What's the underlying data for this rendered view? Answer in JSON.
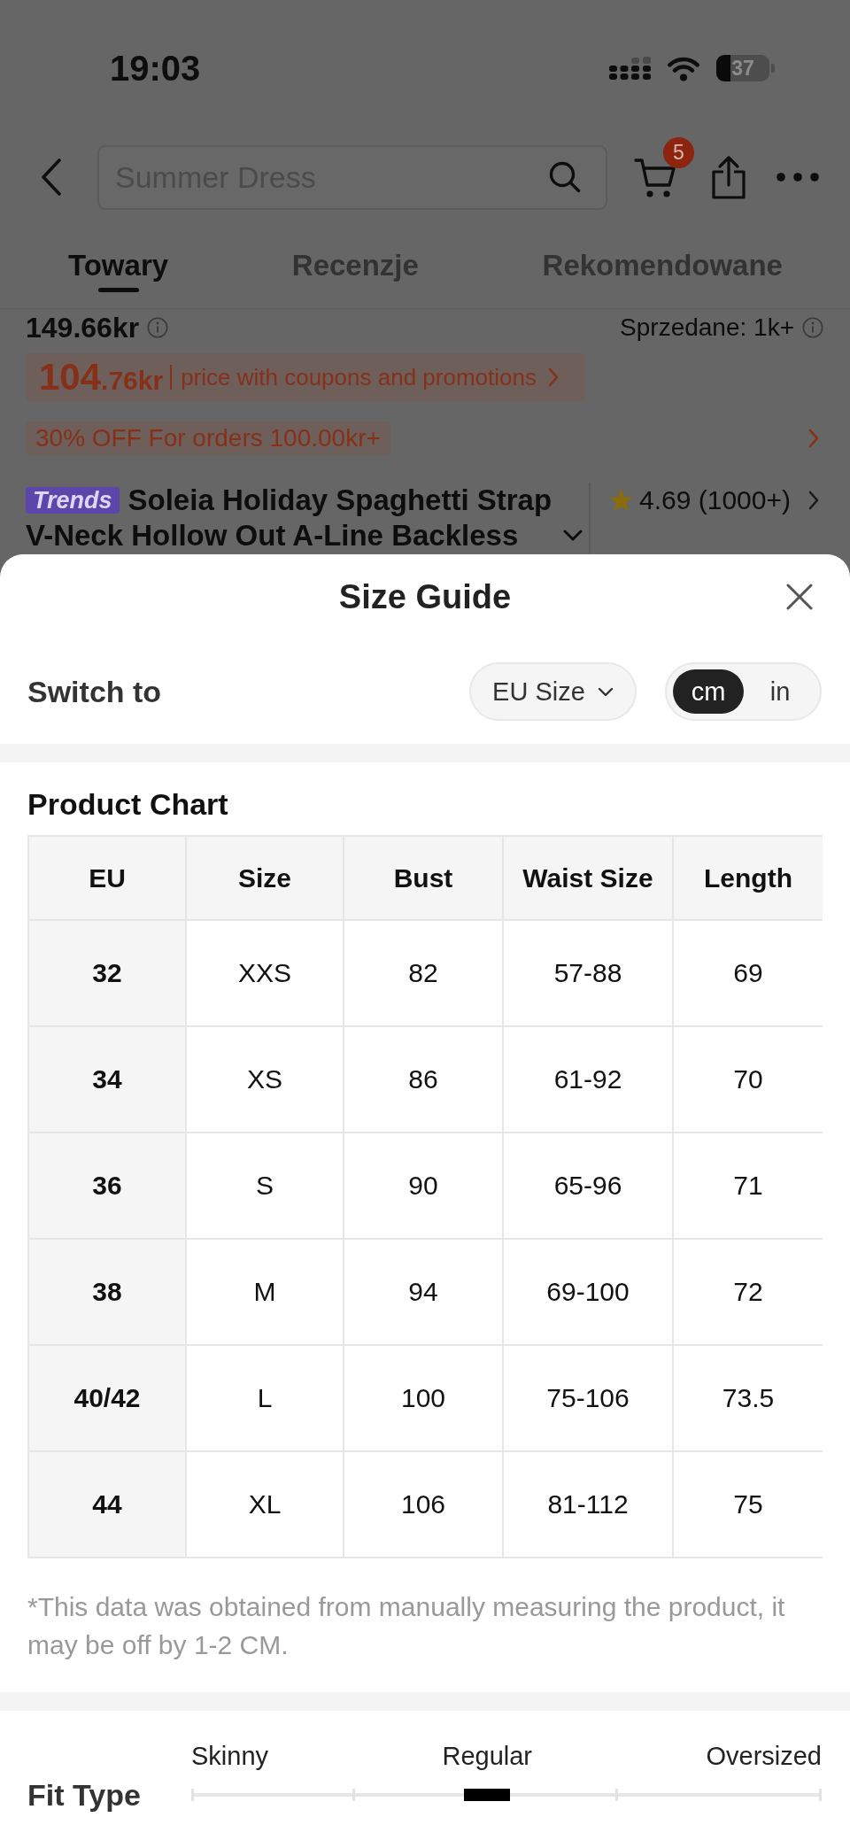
{
  "status_bar": {
    "time": "19:03",
    "battery": "37"
  },
  "nav": {
    "search_placeholder": "Summer Dress",
    "cart_count": "5"
  },
  "tabs": [
    {
      "label": "Towary",
      "selected": true
    },
    {
      "label": "Recenzje",
      "selected": false
    },
    {
      "label": "Rekomendowane",
      "selected": false
    }
  ],
  "product": {
    "price": "149.66kr",
    "sold": "Sprzedane: 1k+",
    "coupon": {
      "price_whole": "104",
      "price_fraction": ".76kr",
      "note": "price with coupons and promotions"
    },
    "promotion": "30% OFF For orders 100.00kr+",
    "badge": "Trends",
    "title": "Soleia Holiday Spaghetti Strap V-Neck Hollow Out A-Line Backless",
    "rating": "4.69 (1000+)"
  },
  "size_guide": {
    "title": "Size Guide",
    "switch_label": "Switch to",
    "size_system": "EU Size",
    "units": [
      {
        "label": "cm",
        "selected": true
      },
      {
        "label": "in",
        "selected": false
      }
    ],
    "chart_title": "Product Chart",
    "table": {
      "columns": [
        "EU",
        "Size",
        "Bust",
        "Waist Size",
        "Length"
      ],
      "rows": [
        [
          "32",
          "XXS",
          "82",
          "57-88",
          "69"
        ],
        [
          "34",
          "XS",
          "86",
          "61-92",
          "70"
        ],
        [
          "36",
          "S",
          "90",
          "65-96",
          "71"
        ],
        [
          "38",
          "M",
          "94",
          "69-100",
          "72"
        ],
        [
          "40/42",
          "L",
          "100",
          "75-106",
          "73.5"
        ],
        [
          "44",
          "XL",
          "106",
          "81-112",
          "75"
        ]
      ]
    },
    "note": "*This data was obtained from manually measuring the product, it may be off by 1-2 CM.",
    "fit_type": {
      "label": "Fit Type",
      "options": [
        {
          "label": "Skinny",
          "selected": false
        },
        {
          "label": "Regular",
          "selected": true
        },
        {
          "label": "Oversized",
          "selected": false
        }
      ]
    }
  }
}
